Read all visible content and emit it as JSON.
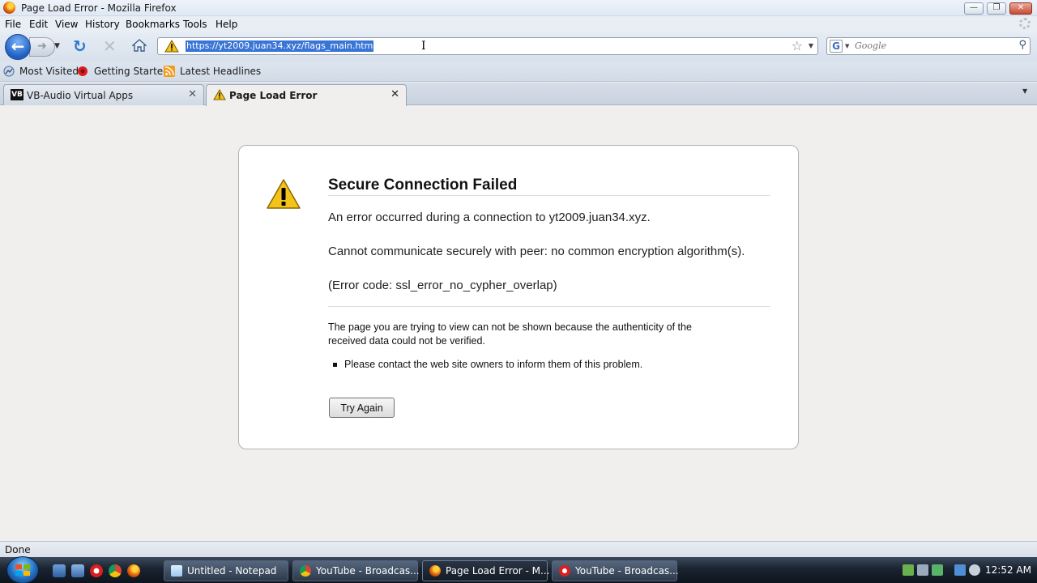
{
  "window": {
    "title": "Page Load Error - Mozilla Firefox"
  },
  "menu": [
    "File",
    "Edit",
    "View",
    "History",
    "Bookmarks",
    "Tools",
    "Help"
  ],
  "navbar": {
    "url": "https://yt2009.juan34.xyz/flags_main.htm",
    "search_placeholder": "Google"
  },
  "bookmarks": [
    "Most Visited",
    "Getting Started",
    "Latest Headlines"
  ],
  "tabs": [
    {
      "label": "VB-Audio Virtual Apps",
      "active": false
    },
    {
      "label": "Page Load Error",
      "active": true
    }
  ],
  "error": {
    "title": "Secure Connection Failed",
    "line1": "An error occurred during a connection to yt2009.juan34.xyz.",
    "line2": "Cannot communicate securely with peer: no common encryption algorithm(s).",
    "line3": "(Error code: ssl_error_no_cypher_overlap)",
    "description": "The page you are trying to view can not be shown because the authenticity of the received data could not be verified.",
    "bullet": "Please contact the web site owners to inform them of this problem.",
    "button": "Try Again"
  },
  "status": {
    "text": "Done"
  },
  "taskbar": {
    "buttons": [
      {
        "label": "Untitled - Notepad",
        "active": false
      },
      {
        "label": "YouTube - Broadcas...",
        "active": false
      },
      {
        "label": "Page Load Error - M...",
        "active": true
      },
      {
        "label": "YouTube - Broadcas...",
        "active": false
      }
    ],
    "clock": "12:52 AM"
  },
  "colors": {
    "accent": "#3875d7",
    "warning": "#f3c21b"
  }
}
